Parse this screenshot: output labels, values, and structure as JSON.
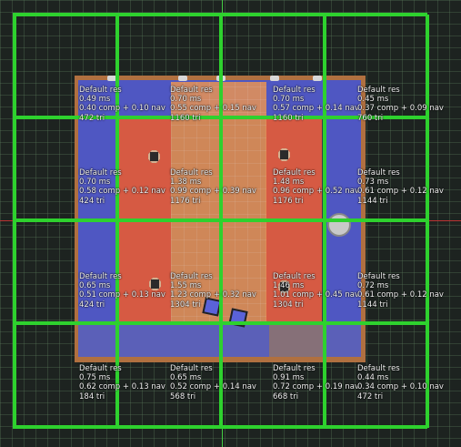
{
  "tiles": [
    {
      "title": "Default res",
      "ms": "0.49 ms",
      "breakdown": "0.40 comp + 0.10 nav",
      "tris": "472 tri"
    },
    {
      "title": "Default res",
      "ms": "0.70 ms",
      "breakdown": "0.55 comp + 0.15 nav",
      "tris": "1160 tri"
    },
    {
      "title": "Default res",
      "ms": "0.70 ms",
      "breakdown": "0.57 comp + 0.14 nav",
      "tris": "1160 tri"
    },
    {
      "title": "Default res",
      "ms": "0.45 ms",
      "breakdown": "0.37 comp + 0.09 nav",
      "tris": "760 tri"
    },
    {
      "title": "Default res",
      "ms": "0.70 ms",
      "breakdown": "0.58 comp + 0.12 nav",
      "tris": "424 tri"
    },
    {
      "title": "Default res",
      "ms": "1.38 ms",
      "breakdown": "0.99 comp + 0.39 nav",
      "tris": "1176 tri"
    },
    {
      "title": "Default res",
      "ms": "1.48 ms",
      "breakdown": "0.96 comp + 0.52 nav",
      "tris": "1176 tri"
    },
    {
      "title": "Default res",
      "ms": "0.73 ms",
      "breakdown": "0.61 comp + 0.12 nav",
      "tris": "1144 tri"
    },
    {
      "title": "Default res",
      "ms": "0.65 ms",
      "breakdown": "0.51 comp + 0.13 nav",
      "tris": "424 tri"
    },
    {
      "title": "Default res",
      "ms": "1.55 ms",
      "breakdown": "1.23 comp + 0.32 nav",
      "tris": "1304 tri"
    },
    {
      "title": "Default res",
      "ms": "1.46 ms",
      "breakdown": "1.01 comp + 0.45 nav",
      "tris": "1304 tri"
    },
    {
      "title": "Default res",
      "ms": "0.72 ms",
      "breakdown": "0.61 comp + 0.12 nav",
      "tris": "1144 tri"
    },
    {
      "title": "Default res",
      "ms": "0.75 ms",
      "breakdown": "0.62 comp + 0.13 nav",
      "tris": "184 tri"
    },
    {
      "title": "Default res",
      "ms": "0.65 ms",
      "breakdown": "0.52 comp + 0.14 nav",
      "tris": "568 tri"
    },
    {
      "title": "Default res",
      "ms": "0.91 ms",
      "breakdown": "0.72 comp + 0.19 nav",
      "tris": "668 tri"
    },
    {
      "title": "Default res",
      "ms": "0.44 ms",
      "breakdown": "0.34 comp + 0.10 nav",
      "tris": "472 tri"
    }
  ],
  "colors": {
    "tile_grid": "#2ed12e",
    "floor": "#4f57c2",
    "room": "#d65a43",
    "platform_edge": "#b07040"
  }
}
